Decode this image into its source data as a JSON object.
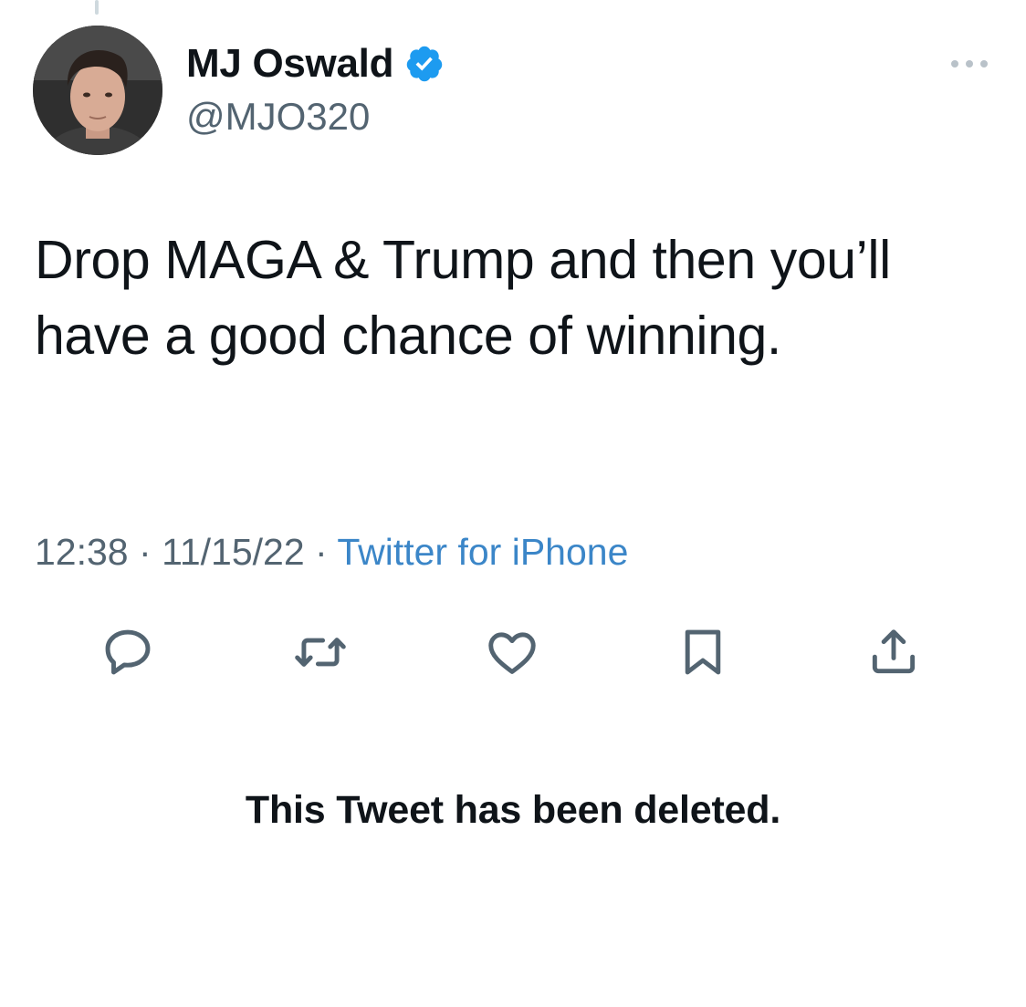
{
  "author": {
    "display_name": "MJ Oswald",
    "handle": "@MJO320",
    "verified": true,
    "avatar_icon": "profile-photo"
  },
  "tweet": {
    "text": "Drop MAGA & Trump and then you’ll have a good chance of winning.",
    "time": "12:38",
    "date": "11/15/22",
    "separator": "·",
    "source": "Twitter for iPhone"
  },
  "actions": [
    {
      "name": "reply",
      "icon": "speech-bubble-icon"
    },
    {
      "name": "retweet",
      "icon": "retweet-arrows-icon"
    },
    {
      "name": "like",
      "icon": "heart-icon"
    },
    {
      "name": "bookmark",
      "icon": "bookmark-icon"
    },
    {
      "name": "share",
      "icon": "share-upload-icon"
    }
  ],
  "notice": {
    "text": "This Tweet has been deleted."
  },
  "colors": {
    "text": "#0f1419",
    "secondary": "#536471",
    "link": "#3b86c8",
    "verified_badge": "#1d9bf0"
  }
}
